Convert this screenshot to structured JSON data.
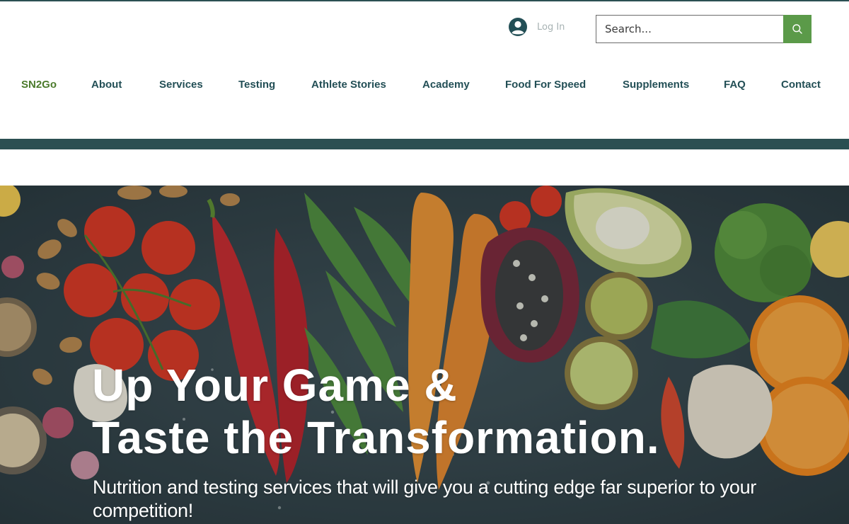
{
  "header": {
    "login_label": "Log In",
    "search_placeholder": "Search..."
  },
  "nav": {
    "items": [
      "SN2Go",
      "About",
      "Services",
      "Testing",
      "Athlete Stories",
      "Academy",
      "Food For Speed",
      "Supplements",
      "FAQ",
      "Contact"
    ],
    "active": "SN2Go"
  },
  "hero": {
    "headline_line1": "Up Your Game &",
    "headline_line2": "Taste the Transformation.",
    "subtext": "Nutrition and testing services that will give you a cutting edge far superior to your competition!"
  },
  "colors": {
    "brand_dark": "#2b4f52",
    "nav_text": "#234f56",
    "nav_active": "#4b7a2b",
    "search_button": "#5b9a49"
  },
  "icons": [
    "avatar-icon",
    "search-icon"
  ]
}
